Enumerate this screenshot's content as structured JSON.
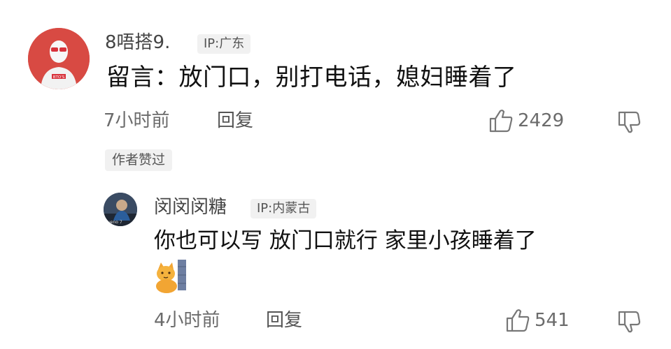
{
  "comment": {
    "username": "8唔搭9.",
    "ip": "IP:广东",
    "text": "留言：放门口，别打电话，媳妇睡着了",
    "time": "7小时前",
    "reply_label": "回复",
    "likes": "2429",
    "author_liked": "作者赞过",
    "avatar_text": "BTO'S"
  },
  "reply": {
    "username": "闵闵闵糖",
    "ip": "IP:内蒙古",
    "text": "你也可以写 放门口就行 家里小孩睡着了",
    "time": "4小时前",
    "reply_label": "回复",
    "likes": "541",
    "avatar_text": "ueno 7"
  },
  "icons": {
    "like": "thumbs-up-icon",
    "dislike": "thumbs-down-icon",
    "sticker": "cat-sticker"
  },
  "colors": {
    "avatar_bg": "#d84a43",
    "badge_bg": "#f1f1f1",
    "meta_text": "#6b6b6b"
  }
}
